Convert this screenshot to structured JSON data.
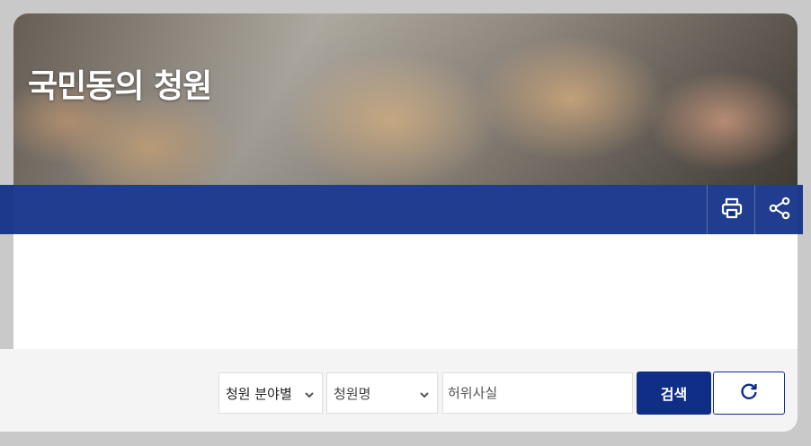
{
  "header": {
    "title": "국민동의 청원",
    "actions": [
      {
        "name": "print",
        "icon": "print-icon"
      },
      {
        "name": "share",
        "icon": "share-icon"
      }
    ]
  },
  "search": {
    "category_select": {
      "selected": "청원 분야별"
    },
    "field_select": {
      "selected": "청원명"
    },
    "keyword": {
      "value": "",
      "placeholder": "허위사실"
    },
    "search_label": "검색",
    "reset_icon": "refresh-icon"
  },
  "colors": {
    "primary": "#0f2e86",
    "background": "#c9c9c9",
    "panel": "#f4f4f4"
  }
}
